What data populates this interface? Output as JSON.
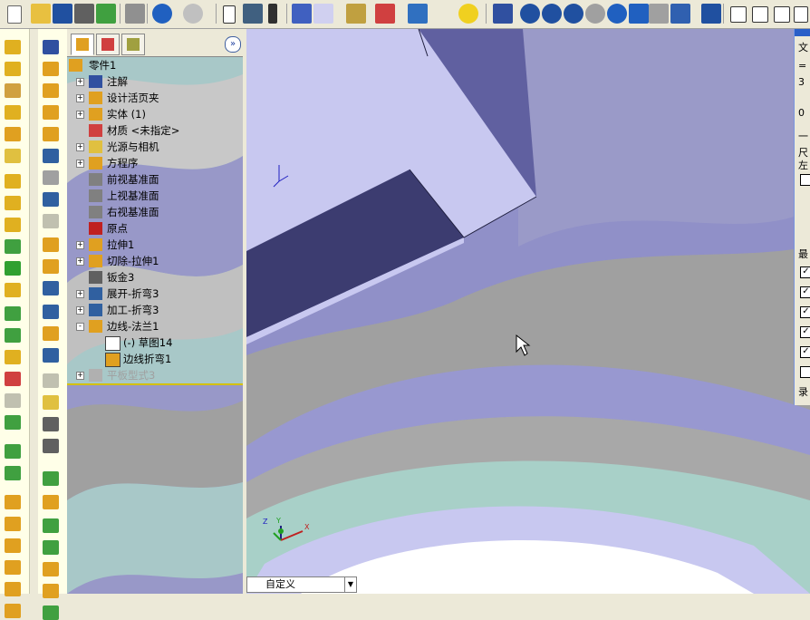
{
  "feature_tree": {
    "root": "零件1",
    "items": [
      {
        "label": "注解",
        "expand": "+"
      },
      {
        "label": "设计活页夹",
        "expand": "+"
      },
      {
        "label": "实体 (1)",
        "expand": "+"
      },
      {
        "label": "材质 <未指定>",
        "expand": ""
      },
      {
        "label": "光源与相机",
        "expand": "+"
      },
      {
        "label": "方程序",
        "expand": "+"
      },
      {
        "label": "前视基准面",
        "expand": ""
      },
      {
        "label": "上视基准面",
        "expand": ""
      },
      {
        "label": "右视基准面",
        "expand": ""
      },
      {
        "label": "原点",
        "expand": ""
      },
      {
        "label": "拉伸1",
        "expand": "+"
      },
      {
        "label": "切除-拉伸1",
        "expand": "+"
      },
      {
        "label": "钣金3",
        "expand": ""
      },
      {
        "label": "展开-折弯3",
        "expand": "+"
      },
      {
        "label": "加工-折弯3",
        "expand": "+"
      },
      {
        "label": "边线-法兰1",
        "expand": "-"
      }
    ],
    "children": [
      {
        "label": "(-) 草图14"
      },
      {
        "label": "边线折弯1"
      }
    ],
    "suppressed": {
      "label": "平板型式3",
      "expand": "+"
    }
  },
  "status_bar": {
    "view_name": "自定义"
  },
  "right_panel": {
    "labels": [
      "文",
      "=",
      "3",
      "0",
      "一",
      "尺",
      "左",
      "最",
      "录"
    ]
  },
  "triad": {
    "x": "X",
    "y": "Y",
    "z": "Z"
  },
  "colors": {
    "part_light": "#c8c8f0",
    "part_dark": "#6060a0",
    "background_gray": "#a0a0a0",
    "background_purple": "#9090c8",
    "tree_highlight": "#d4c000"
  }
}
